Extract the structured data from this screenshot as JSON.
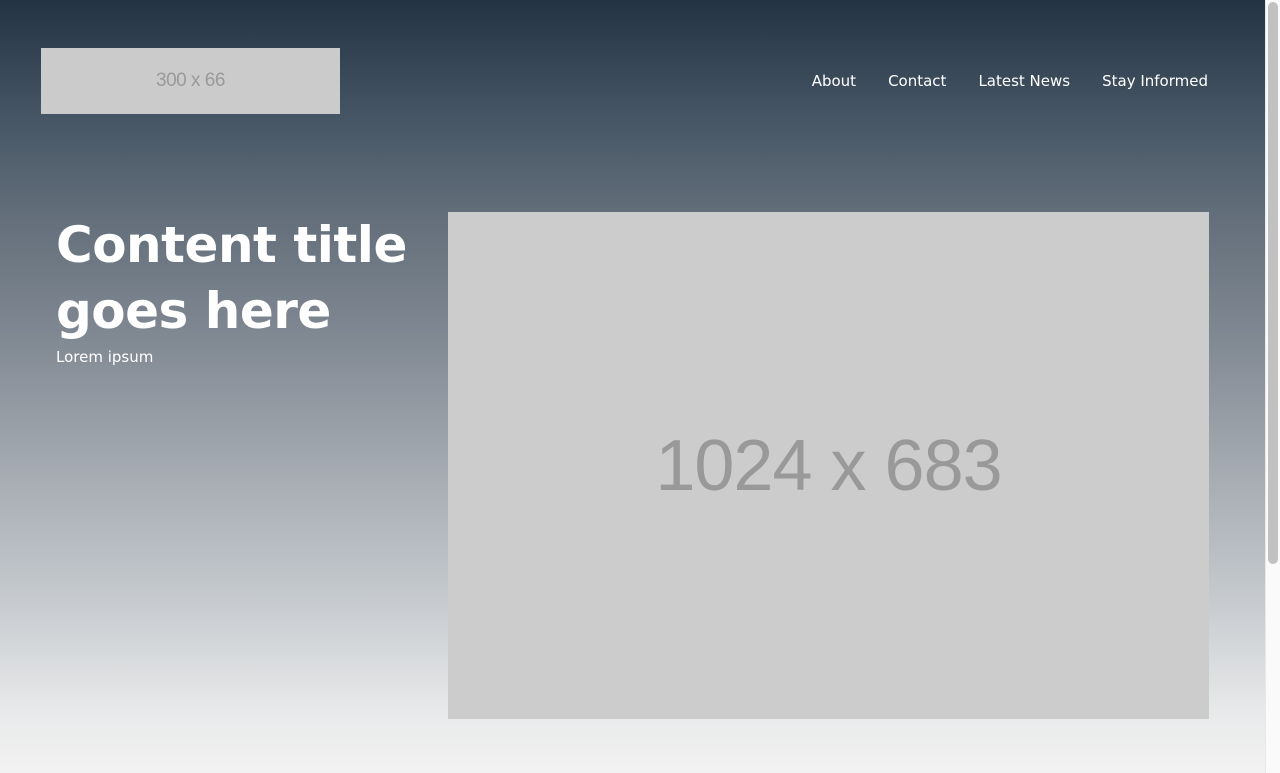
{
  "header": {
    "logo_text": "300 x 66",
    "nav": [
      {
        "label": "About"
      },
      {
        "label": "Contact"
      },
      {
        "label": "Latest News"
      },
      {
        "label": "Stay Informed"
      }
    ]
  },
  "hero": {
    "title": "Content title goes here",
    "subtitle": "Lorem ipsum",
    "image_text": "1024 x 683"
  },
  "colors": {
    "gradient_top": "#243343",
    "gradient_bottom": "#f2f2f2",
    "placeholder_bg": "#cccccc",
    "placeholder_text": "#999999",
    "text": "#ffffff"
  }
}
